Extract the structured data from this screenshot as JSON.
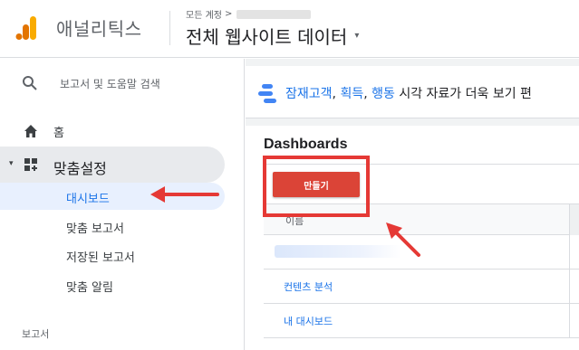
{
  "header": {
    "app_name": "애널리틱스",
    "account_prefix": "모든 계정",
    "account_sep": ">",
    "view_name": "전체 웹사이트 데이터",
    "view_caret": "▾"
  },
  "sidebar": {
    "search_label": "보고서 및 도움말 검색",
    "home_label": "홈",
    "custom_label": "맞춤설정",
    "custom_caret": "▾",
    "sub_items": [
      {
        "label": "대시보드",
        "active": true
      },
      {
        "label": "맞춤 보고서",
        "active": false
      },
      {
        "label": "저장된 보고서",
        "active": false
      },
      {
        "label": "맞춤 알림",
        "active": false
      }
    ],
    "section_label": "보고서"
  },
  "banner": {
    "link_part1": "잠재고객",
    "sep1": ", ",
    "link_part2": "획득",
    "sep2": ", ",
    "link_part3": "행동",
    "rest": " 시각 자료가 더욱 보기 편"
  },
  "content": {
    "title": "Dashboards",
    "create_button": "만들기",
    "table_header_name": "이름",
    "rows": [
      {
        "label": ""
      },
      {
        "label": "컨텐츠 분석"
      },
      {
        "label": "내 대시보드"
      }
    ]
  },
  "colors": {
    "accent_blue": "#1a73e8",
    "create_red": "#db4437",
    "annotation_red": "#e53935",
    "logo_orange": "#f9ab00",
    "logo_dark_orange": "#e37400"
  }
}
